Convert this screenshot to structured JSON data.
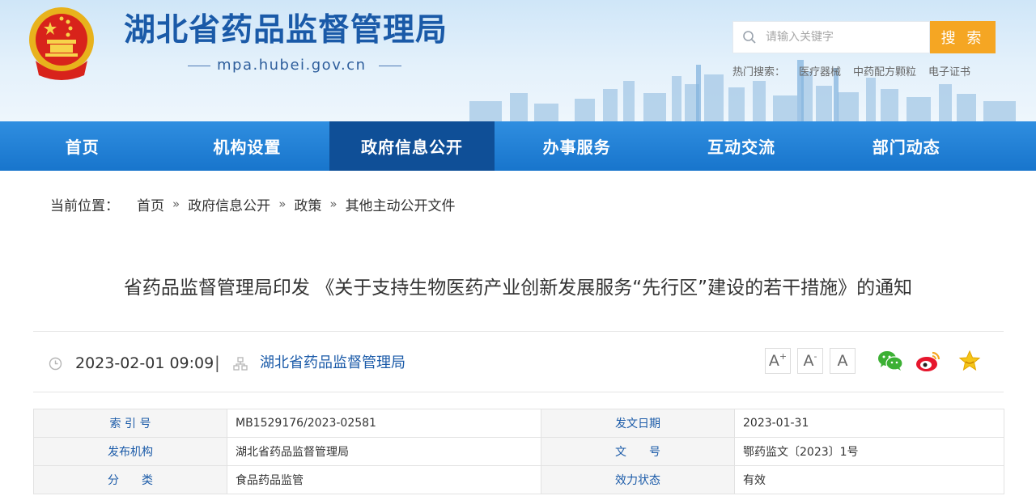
{
  "header": {
    "site_title": "湖北省药品监督管理局",
    "domain": "mpa.hubei.gov.cn",
    "search": {
      "placeholder": "请输入关键字",
      "button_label": "搜 索"
    },
    "hot_search": {
      "label": "热门搜索：",
      "items": [
        "医疗器械",
        "中药配方颗粒",
        "电子证书"
      ]
    },
    "icons": [
      "national-emblem-icon",
      "search-icon"
    ]
  },
  "nav": {
    "items": [
      "首页",
      "机构设置",
      "政府信息公开",
      "办事服务",
      "互动交流",
      "部门动态"
    ],
    "active": "政府信息公开"
  },
  "breadcrumb": {
    "label": "当前位置：",
    "items": [
      "首页",
      "政府信息公开",
      "政策",
      "其他主动公开文件"
    ],
    "separator": "»"
  },
  "article": {
    "title": "省药品监督管理局印发 《关于支持生物医药产业创新发展服务“先行区”建设的若干措施》的通知",
    "datetime": "2023-02-01 09:09",
    "separator": "|",
    "source": "湖北省药品监督管理局",
    "font_buttons": {
      "increase": "A",
      "decrease": "A",
      "reset": "A",
      "increase_mark": "+",
      "decrease_mark": "-"
    },
    "share_icons": [
      "wechat-icon",
      "weibo-icon",
      "favorite-star-icon"
    ]
  },
  "info_table": {
    "rows": [
      {
        "k1": "索 引 号",
        "v1": "MB1529176/2023-02581",
        "k2": "发文日期",
        "v2": "2023-01-31"
      },
      {
        "k1": "发布机构",
        "v1": "湖北省药品监督管理局",
        "k2": "文　　号",
        "v2": "鄂药监文〔2023〕1号"
      },
      {
        "k1": "分　　类",
        "v1": "食品药品监管",
        "k2": "效力状态",
        "v2": "有效"
      }
    ]
  },
  "colors": {
    "brand_blue": "#1a5aa8",
    "nav_blue": "#1875cc",
    "nav_active": "#0f4f97",
    "search_button": "#f5a623"
  }
}
